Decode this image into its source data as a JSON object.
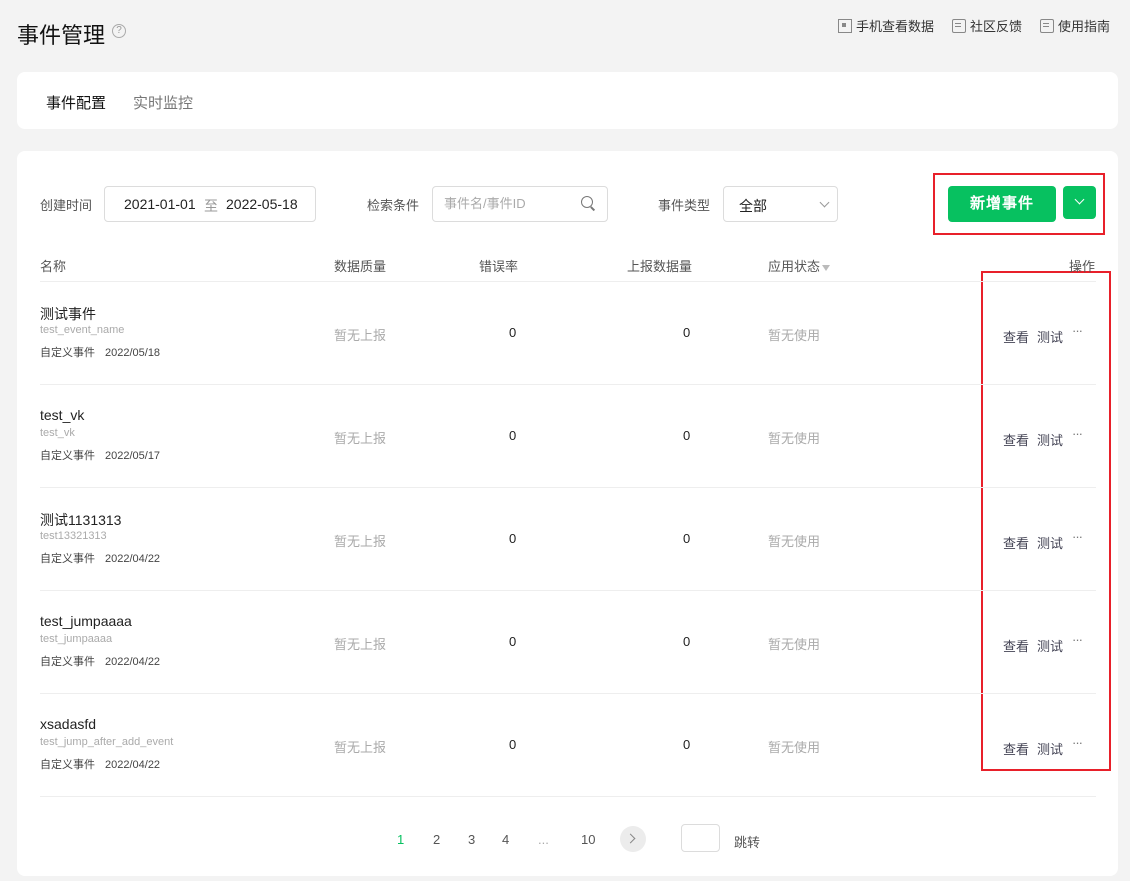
{
  "header": {
    "title": "事件管理",
    "help": "?",
    "links": [
      {
        "label": "手机查看数据",
        "icon": "qr-code-icon"
      },
      {
        "label": "社区反馈",
        "icon": "feedback-icon"
      },
      {
        "label": "使用指南",
        "icon": "guide-icon"
      }
    ]
  },
  "tabs": [
    {
      "label": "事件配置",
      "active": true
    },
    {
      "label": "实时监控",
      "active": false
    }
  ],
  "filters": {
    "created_label": "创建时间",
    "date_start": "2021-01-01",
    "date_sep": "至",
    "date_end": "2022-05-18",
    "search_label": "检索条件",
    "search_placeholder": "事件名/事件ID",
    "search_value": "",
    "type_label": "事件类型",
    "type_value": "全部"
  },
  "actions": {
    "add_label": "新增事件"
  },
  "table": {
    "headers": {
      "name": "名称",
      "quality": "数据质量",
      "error_rate": "错误率",
      "volume": "上报数据量",
      "status": "应用状态",
      "ops": "操作"
    },
    "rows": [
      {
        "name": "测试事件",
        "id": "test_event_name",
        "type": "自定义事件",
        "date": "2022/05/18",
        "quality": "暂无上报",
        "error_rate": "0",
        "volume": "0",
        "status": "暂无使用",
        "view": "查看",
        "test": "测试",
        "more": "···"
      },
      {
        "name": "test_vk",
        "id": "test_vk",
        "type": "自定义事件",
        "date": "2022/05/17",
        "quality": "暂无上报",
        "error_rate": "0",
        "volume": "0",
        "status": "暂无使用",
        "view": "查看",
        "test": "测试",
        "more": "···"
      },
      {
        "name": "测试1131313",
        "id": "test13321313",
        "type": "自定义事件",
        "date": "2022/04/22",
        "quality": "暂无上报",
        "error_rate": "0",
        "volume": "0",
        "status": "暂无使用",
        "view": "查看",
        "test": "测试",
        "more": "···"
      },
      {
        "name": "test_jumpaaaa",
        "id": "test_jumpaaaa",
        "type": "自定义事件",
        "date": "2022/04/22",
        "quality": "暂无上报",
        "error_rate": "0",
        "volume": "0",
        "status": "暂无使用",
        "view": "查看",
        "test": "测试",
        "more": "···"
      },
      {
        "name": "xsadasfd",
        "id": "test_jump_after_add_event",
        "type": "自定义事件",
        "date": "2022/04/22",
        "quality": "暂无上报",
        "error_rate": "0",
        "volume": "0",
        "status": "暂无使用",
        "view": "查看",
        "test": "测试",
        "more": "···"
      }
    ]
  },
  "pagination": {
    "pages": [
      "1",
      "2",
      "3",
      "4",
      "...",
      "10"
    ],
    "current": "1",
    "jump_label": "跳转"
  },
  "colors": {
    "primary": "#07c160",
    "highlight": "#e8202a"
  }
}
